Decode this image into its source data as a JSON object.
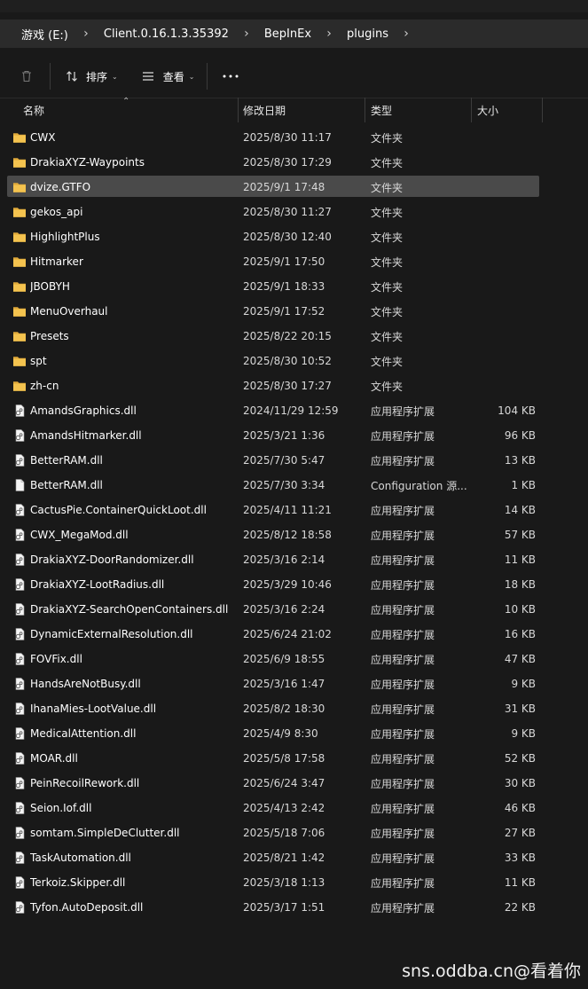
{
  "breadcrumb": [
    {
      "label": "游戏 (E:)"
    },
    {
      "label": "Client.0.16.1.3.35392"
    },
    {
      "label": "BepInEx"
    },
    {
      "label": "plugins"
    }
  ],
  "toolbar": {
    "sort_label": "排序",
    "view_label": "查看"
  },
  "columns": {
    "name": "名称",
    "date": "修改日期",
    "type": "类型",
    "size": "大小"
  },
  "files": [
    {
      "name": "CWX",
      "date": "2025/8/30 11:17",
      "type": "文件夹",
      "size": "",
      "kind": "folder"
    },
    {
      "name": "DrakiaXYZ-Waypoints",
      "date": "2025/8/30 17:29",
      "type": "文件夹",
      "size": "",
      "kind": "folder"
    },
    {
      "name": "dvize.GTFO",
      "date": "2025/9/1 17:48",
      "type": "文件夹",
      "size": "",
      "kind": "folder",
      "selected": true
    },
    {
      "name": "gekos_api",
      "date": "2025/8/30 11:27",
      "type": "文件夹",
      "size": "",
      "kind": "folder"
    },
    {
      "name": "HighlightPlus",
      "date": "2025/8/30 12:40",
      "type": "文件夹",
      "size": "",
      "kind": "folder"
    },
    {
      "name": "Hitmarker",
      "date": "2025/9/1 17:50",
      "type": "文件夹",
      "size": "",
      "kind": "folder"
    },
    {
      "name": "JBOBYH",
      "date": "2025/9/1 18:33",
      "type": "文件夹",
      "size": "",
      "kind": "folder"
    },
    {
      "name": "MenuOverhaul",
      "date": "2025/9/1 17:52",
      "type": "文件夹",
      "size": "",
      "kind": "folder"
    },
    {
      "name": "Presets",
      "date": "2025/8/22 20:15",
      "type": "文件夹",
      "size": "",
      "kind": "folder"
    },
    {
      "name": "spt",
      "date": "2025/8/30 10:52",
      "type": "文件夹",
      "size": "",
      "kind": "folder"
    },
    {
      "name": "zh-cn",
      "date": "2025/8/30 17:27",
      "type": "文件夹",
      "size": "",
      "kind": "folder"
    },
    {
      "name": "AmandsGraphics.dll",
      "date": "2024/11/29 12:59",
      "type": "应用程序扩展",
      "size": "104 KB",
      "kind": "dll"
    },
    {
      "name": "AmandsHitmarker.dll",
      "date": "2025/3/21 1:36",
      "type": "应用程序扩展",
      "size": "96 KB",
      "kind": "dll"
    },
    {
      "name": "BetterRAM.dll",
      "date": "2025/7/30 5:47",
      "type": "应用程序扩展",
      "size": "13 KB",
      "kind": "dll"
    },
    {
      "name": "BetterRAM.dll",
      "date": "2025/7/30 3:34",
      "type": "Configuration 源...",
      "size": "1 KB",
      "kind": "file"
    },
    {
      "name": "CactusPie.ContainerQuickLoot.dll",
      "date": "2025/4/11 11:21",
      "type": "应用程序扩展",
      "size": "14 KB",
      "kind": "dll"
    },
    {
      "name": "CWX_MegaMod.dll",
      "date": "2025/8/12 18:58",
      "type": "应用程序扩展",
      "size": "57 KB",
      "kind": "dll"
    },
    {
      "name": "DrakiaXYZ-DoorRandomizer.dll",
      "date": "2025/3/16 2:14",
      "type": "应用程序扩展",
      "size": "11 KB",
      "kind": "dll"
    },
    {
      "name": "DrakiaXYZ-LootRadius.dll",
      "date": "2025/3/29 10:46",
      "type": "应用程序扩展",
      "size": "18 KB",
      "kind": "dll"
    },
    {
      "name": "DrakiaXYZ-SearchOpenContainers.dll",
      "date": "2025/3/16 2:24",
      "type": "应用程序扩展",
      "size": "10 KB",
      "kind": "dll"
    },
    {
      "name": "DynamicExternalResolution.dll",
      "date": "2025/6/24 21:02",
      "type": "应用程序扩展",
      "size": "16 KB",
      "kind": "dll"
    },
    {
      "name": "FOVFix.dll",
      "date": "2025/6/9 18:55",
      "type": "应用程序扩展",
      "size": "47 KB",
      "kind": "dll"
    },
    {
      "name": "HandsAreNotBusy.dll",
      "date": "2025/3/16 1:47",
      "type": "应用程序扩展",
      "size": "9 KB",
      "kind": "dll"
    },
    {
      "name": "IhanaMies-LootValue.dll",
      "date": "2025/8/2 18:30",
      "type": "应用程序扩展",
      "size": "31 KB",
      "kind": "dll"
    },
    {
      "name": "MedicalAttention.dll",
      "date": "2025/4/9 8:30",
      "type": "应用程序扩展",
      "size": "9 KB",
      "kind": "dll"
    },
    {
      "name": "MOAR.dll",
      "date": "2025/5/8 17:58",
      "type": "应用程序扩展",
      "size": "52 KB",
      "kind": "dll"
    },
    {
      "name": "PeinRecoilRework.dll",
      "date": "2025/6/24 3:47",
      "type": "应用程序扩展",
      "size": "30 KB",
      "kind": "dll"
    },
    {
      "name": "Seion.Iof.dll",
      "date": "2025/4/13 2:42",
      "type": "应用程序扩展",
      "size": "46 KB",
      "kind": "dll"
    },
    {
      "name": "somtam.SimpleDeClutter.dll",
      "date": "2025/5/18 7:06",
      "type": "应用程序扩展",
      "size": "27 KB",
      "kind": "dll"
    },
    {
      "name": "TaskAutomation.dll",
      "date": "2025/8/21 1:42",
      "type": "应用程序扩展",
      "size": "33 KB",
      "kind": "dll"
    },
    {
      "name": "Terkoiz.Skipper.dll",
      "date": "2025/3/18 1:13",
      "type": "应用程序扩展",
      "size": "11 KB",
      "kind": "dll"
    },
    {
      "name": "Tyfon.AutoDeposit.dll",
      "date": "2025/3/17 1:51",
      "type": "应用程序扩展",
      "size": "22 KB",
      "kind": "dll"
    }
  ],
  "watermark": "sns.oddba.cn@看着你",
  "colors": {
    "background": "#191919",
    "address_bar": "#2b2b2b",
    "selection": "#4a4a4a",
    "folder": "#f4c34f"
  }
}
